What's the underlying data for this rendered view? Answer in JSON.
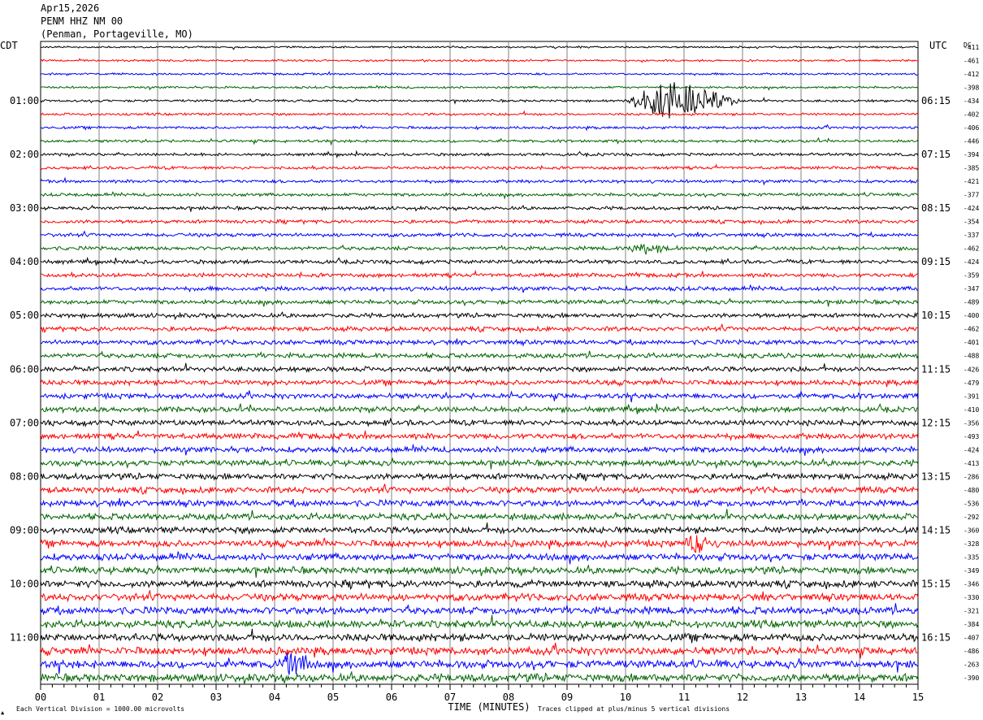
{
  "header": {
    "date": "Apr15,2026",
    "station": "PENM HHZ NM 00",
    "location": "(Penman, Portageville, MO)"
  },
  "chart_data": {
    "type": "line",
    "left_tz_label": "CDT",
    "right_tz_label": "UTC",
    "dc_label": "DC",
    "left_hour_labels": [
      "01:00",
      "02:00",
      "03:00",
      "04:00",
      "05:00",
      "06:00",
      "07:00",
      "08:00",
      "09:00",
      "10:00",
      "11:00"
    ],
    "right_hour_labels": [
      "06:15",
      "07:15",
      "08:15",
      "09:15",
      "10:15",
      "11:15",
      "12:15",
      "13:15",
      "14:15",
      "15:15",
      "16:15"
    ],
    "dc_offsets": [
      "-411",
      "-461",
      "-412",
      "-398",
      "-434",
      "-402",
      "-406",
      "-446",
      "-394",
      "-385",
      "-421",
      "-377",
      "-424",
      "-354",
      "-337",
      "-462",
      "-424",
      "-359",
      "-347",
      "-489",
      "-400",
      "-462",
      "-401",
      "-488",
      "-426",
      "-479",
      "-391",
      "-410",
      "-356",
      "-493",
      "-424",
      "-413",
      "-286",
      "-480",
      "-536",
      "-292",
      "-360",
      "-328",
      "-335",
      "-349",
      "-346",
      "-330",
      "-321",
      "-384",
      "-407",
      "-486",
      "-263",
      "-390"
    ],
    "x_tick_labels": [
      "00",
      "01",
      "02",
      "03",
      "04",
      "05",
      "06",
      "07",
      "08",
      "09",
      "10",
      "11",
      "12",
      "13",
      "14",
      "15"
    ],
    "xlabel": "TIME (MINUTES)",
    "xlim": [
      0,
      15
    ],
    "trace_colors": [
      "#000000",
      "#ff0000",
      "#0000ff",
      "#006400"
    ],
    "trace_count": 48,
    "minutes_per_trace": 15,
    "footer_left": "Each Vertical Division = 1000.00 microvolts",
    "footer_right": "Traces clipped at plus/minus 5 vertical divisions",
    "corner_mark": "▲",
    "events": [
      {
        "trace": 4,
        "start_min": 10.0,
        "end_min": 12.0,
        "peak_min": 10.7,
        "amplitude": 22
      },
      {
        "trace": 15,
        "start_min": 10.0,
        "end_min": 10.8,
        "peak_min": 10.3,
        "amplitude": 6
      },
      {
        "trace": 37,
        "start_min": 11.0,
        "end_min": 11.5,
        "peak_min": 11.15,
        "amplitude": 10
      },
      {
        "trace": 46,
        "start_min": 4.0,
        "end_min": 4.6,
        "peak_min": 4.3,
        "amplitude": 14
      }
    ]
  }
}
